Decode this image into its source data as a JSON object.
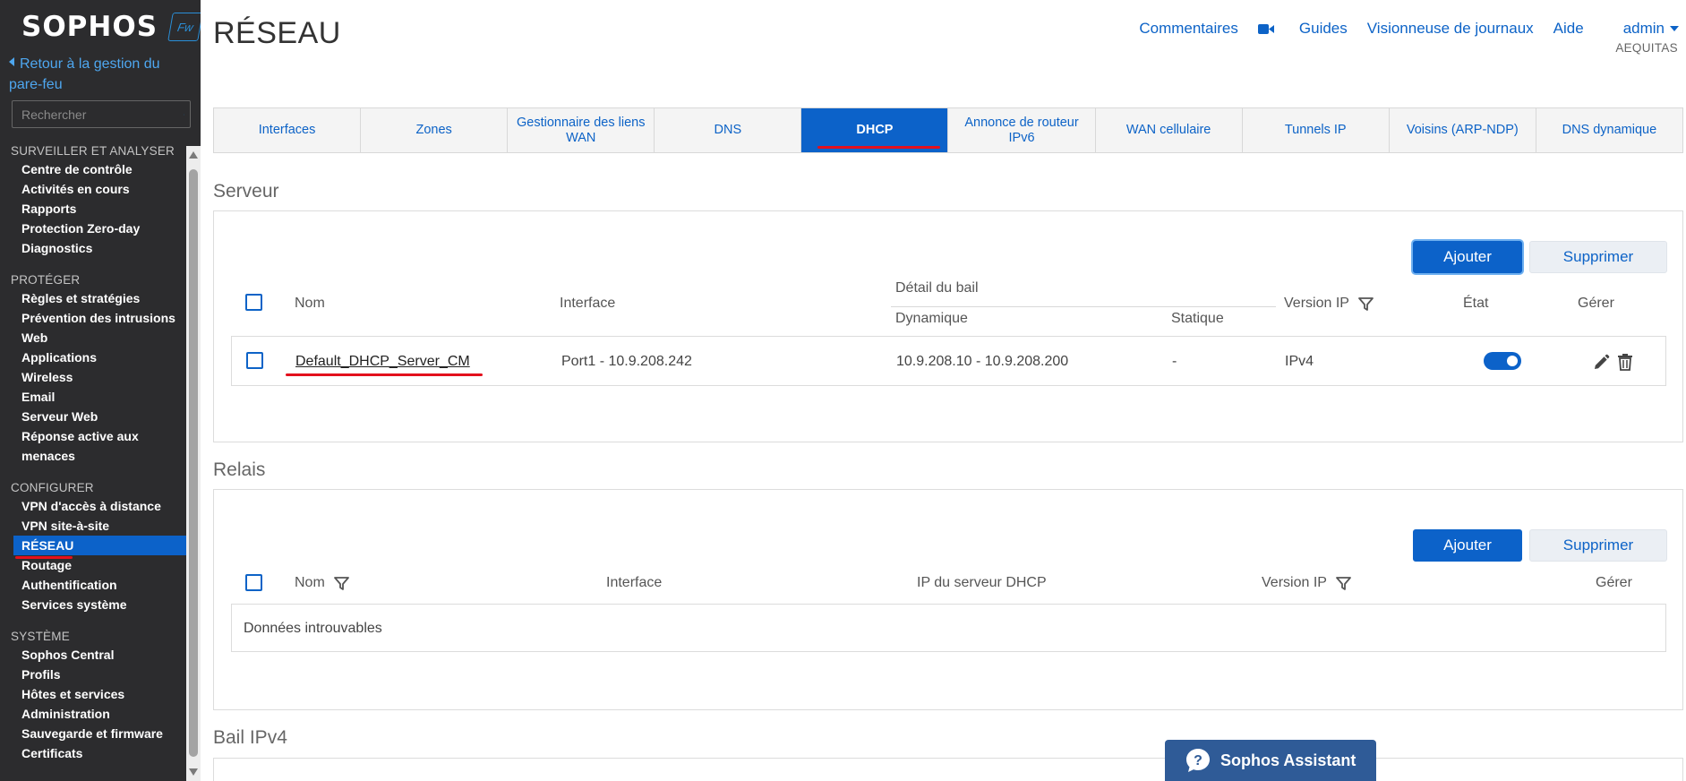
{
  "brand": {
    "name": "SOPHOS",
    "badge": "Fw"
  },
  "sidebar": {
    "back_link": "Retour à la gestion du pare-feu",
    "search_placeholder": "Rechercher",
    "groups": [
      {
        "title": "SURVEILLER ET ANALYSER",
        "items": [
          "Centre de contrôle",
          "Activités en cours",
          "Rapports",
          "Protection Zero-day",
          "Diagnostics"
        ]
      },
      {
        "title": "PROTÉGER",
        "items": [
          "Règles et stratégies",
          "Prévention des intrusions",
          "Web",
          "Applications",
          "Wireless",
          "Email",
          "Serveur Web",
          "Réponse active aux menaces"
        ]
      },
      {
        "title": "CONFIGURER",
        "items": [
          "VPN d'accès à distance",
          "VPN site-à-site",
          "RÉSEAU",
          "Routage",
          "Authentification",
          "Services système"
        ]
      },
      {
        "title": "SYSTÈME",
        "items": [
          "Sophos Central",
          "Profils",
          "Hôtes et services",
          "Administration",
          "Sauvegarde et firmware",
          "Certificats"
        ]
      }
    ]
  },
  "header": {
    "title": "RÉSEAU",
    "links": {
      "comments": "Commentaires",
      "guides": "Guides",
      "log_viewer": "Visionneuse de journaux",
      "help": "Aide",
      "user": "admin"
    },
    "tenant": "AEQUITAS"
  },
  "tabs": [
    "Interfaces",
    "Zones",
    "Gestionnaire des liens WAN",
    "DNS",
    "DHCP",
    "Annonce de routeur IPv6",
    "WAN cellulaire",
    "Tunnels IP",
    "Voisins (ARP-NDP)",
    "DNS dynamique"
  ],
  "server": {
    "title": "Serveur",
    "add_label": "Ajouter",
    "delete_label": "Supprimer",
    "headers": {
      "name": "Nom",
      "interface": "Interface",
      "lease_detail": "Détail du bail",
      "dynamic": "Dynamique",
      "static": "Statique",
      "ip_version": "Version IP",
      "state": "État",
      "manage": "Gérer"
    },
    "row": {
      "name": "Default_DHCP_Server_CM",
      "interface": "Port1 - 10.9.208.242",
      "dynamic": "10.9.208.10 - 10.9.208.200",
      "static": "-",
      "ip_version": "IPv4",
      "enabled": true
    }
  },
  "relay": {
    "title": "Relais",
    "add_label": "Ajouter",
    "delete_label": "Supprimer",
    "headers": {
      "name": "Nom",
      "interface": "Interface",
      "dhcp_server_ip": "IP du serveur DHCP",
      "ip_version": "Version IP",
      "manage": "Gérer"
    },
    "empty": "Données introuvables"
  },
  "lease": {
    "title": "Bail IPv4"
  },
  "assistant": {
    "label": "Sophos Assistant"
  },
  "colors": {
    "accent": "#0c62c9",
    "sidebar_bg": "#2c2c2e",
    "highlight_red": "#e3101d",
    "link_blue": "#0d63c7"
  }
}
